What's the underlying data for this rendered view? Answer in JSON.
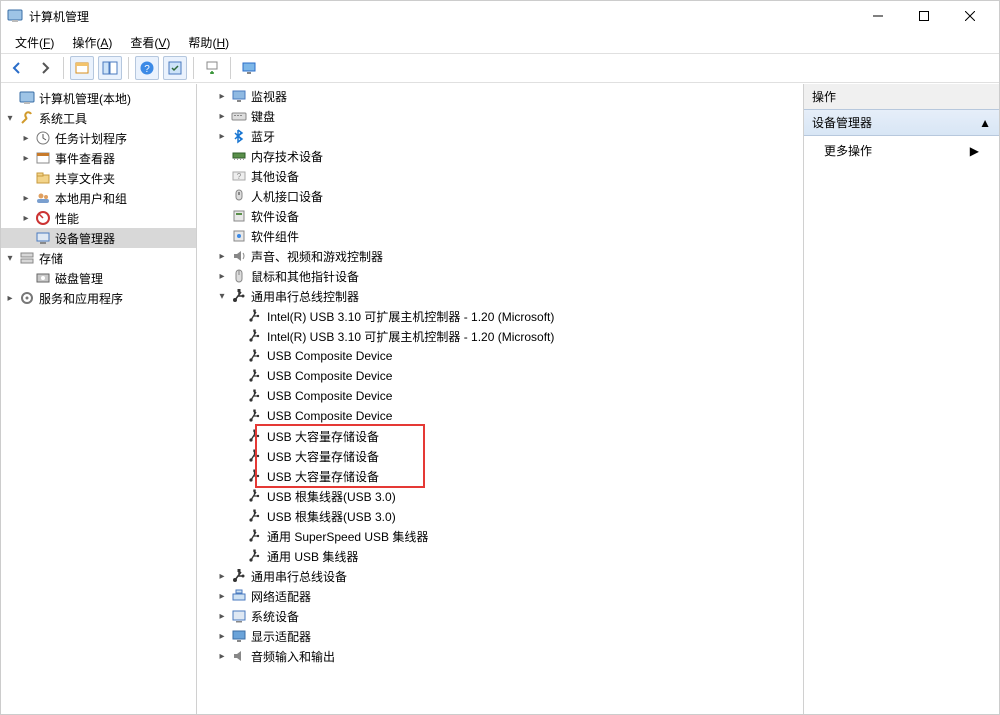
{
  "window": {
    "title": "计算机管理"
  },
  "menubar": [
    {
      "label": "文件",
      "mnemonic": "F"
    },
    {
      "label": "操作",
      "mnemonic": "A"
    },
    {
      "label": "查看",
      "mnemonic": "V"
    },
    {
      "label": "帮助",
      "mnemonic": "H"
    }
  ],
  "left_tree": [
    {
      "indent": 0,
      "twisty": "none",
      "icon": "computer-mgmt",
      "label": "计算机管理(本地)"
    },
    {
      "indent": 0,
      "twisty": "open",
      "icon": "tools",
      "label": "系统工具"
    },
    {
      "indent": 1,
      "twisty": "closed",
      "icon": "task-scheduler",
      "label": "任务计划程序"
    },
    {
      "indent": 1,
      "twisty": "closed",
      "icon": "event-viewer",
      "label": "事件查看器"
    },
    {
      "indent": 1,
      "twisty": "none",
      "icon": "shared-folders",
      "label": "共享文件夹"
    },
    {
      "indent": 1,
      "twisty": "closed",
      "icon": "users-groups",
      "label": "本地用户和组"
    },
    {
      "indent": 1,
      "twisty": "closed",
      "icon": "performance",
      "label": "性能"
    },
    {
      "indent": 1,
      "twisty": "none",
      "icon": "device-mgr",
      "label": "设备管理器",
      "selected": true
    },
    {
      "indent": 0,
      "twisty": "open",
      "icon": "storage",
      "label": "存储"
    },
    {
      "indent": 1,
      "twisty": "none",
      "icon": "disk-mgmt",
      "label": "磁盘管理"
    },
    {
      "indent": 0,
      "twisty": "closed",
      "icon": "services-apps",
      "label": "服务和应用程序"
    }
  ],
  "mid_tree": [
    {
      "indent": 0,
      "twisty": "closed",
      "icon": "monitor",
      "label": "监视器"
    },
    {
      "indent": 0,
      "twisty": "closed",
      "icon": "keyboard",
      "label": "键盘"
    },
    {
      "indent": 0,
      "twisty": "closed",
      "icon": "bluetooth",
      "label": "蓝牙"
    },
    {
      "indent": 0,
      "twisty": "none",
      "icon": "memory",
      "label": "内存技术设备"
    },
    {
      "indent": 0,
      "twisty": "none",
      "icon": "other",
      "label": "其他设备"
    },
    {
      "indent": 0,
      "twisty": "none",
      "icon": "hid",
      "label": "人机接口设备"
    },
    {
      "indent": 0,
      "twisty": "none",
      "icon": "software",
      "label": "软件设备"
    },
    {
      "indent": 0,
      "twisty": "none",
      "icon": "software-component",
      "label": "软件组件"
    },
    {
      "indent": 0,
      "twisty": "closed",
      "icon": "sound",
      "label": "声音、视频和游戏控制器"
    },
    {
      "indent": 0,
      "twisty": "closed",
      "icon": "mouse",
      "label": "鼠标和其他指针设备"
    },
    {
      "indent": 0,
      "twisty": "open",
      "icon": "usb-controller",
      "label": "通用串行总线控制器"
    },
    {
      "indent": 1,
      "twisty": "none",
      "icon": "usb",
      "label": "Intel(R) USB 3.10 可扩展主机控制器 - 1.20 (Microsoft)"
    },
    {
      "indent": 1,
      "twisty": "none",
      "icon": "usb",
      "label": "Intel(R) USB 3.10 可扩展主机控制器 - 1.20 (Microsoft)"
    },
    {
      "indent": 1,
      "twisty": "none",
      "icon": "usb",
      "label": "USB Composite Device"
    },
    {
      "indent": 1,
      "twisty": "none",
      "icon": "usb",
      "label": "USB Composite Device"
    },
    {
      "indent": 1,
      "twisty": "none",
      "icon": "usb",
      "label": "USB Composite Device"
    },
    {
      "indent": 1,
      "twisty": "none",
      "icon": "usb",
      "label": "USB Composite Device"
    },
    {
      "indent": 1,
      "twisty": "none",
      "icon": "usb",
      "label": "USB 大容量存储设备",
      "highlight": "start"
    },
    {
      "indent": 1,
      "twisty": "none",
      "icon": "usb",
      "label": "USB 大容量存储设备"
    },
    {
      "indent": 1,
      "twisty": "none",
      "icon": "usb",
      "label": "USB 大容量存储设备",
      "highlight": "end"
    },
    {
      "indent": 1,
      "twisty": "none",
      "icon": "usb",
      "label": "USB 根集线器(USB 3.0)"
    },
    {
      "indent": 1,
      "twisty": "none",
      "icon": "usb",
      "label": "USB 根集线器(USB 3.0)"
    },
    {
      "indent": 1,
      "twisty": "none",
      "icon": "usb",
      "label": "通用 SuperSpeed USB 集线器"
    },
    {
      "indent": 1,
      "twisty": "none",
      "icon": "usb",
      "label": "通用 USB 集线器"
    },
    {
      "indent": 0,
      "twisty": "closed",
      "icon": "usb-controller",
      "label": "通用串行总线设备"
    },
    {
      "indent": 0,
      "twisty": "closed",
      "icon": "network",
      "label": "网络适配器"
    },
    {
      "indent": 0,
      "twisty": "closed",
      "icon": "system-device",
      "label": "系统设备"
    },
    {
      "indent": 0,
      "twisty": "closed",
      "icon": "display",
      "label": "显示适配器"
    },
    {
      "indent": 0,
      "twisty": "closed",
      "icon": "audio-io",
      "label": "音频输入和输出"
    }
  ],
  "right_panel": {
    "header": "操作",
    "section": "设备管理器",
    "more_actions": "更多操作"
  }
}
